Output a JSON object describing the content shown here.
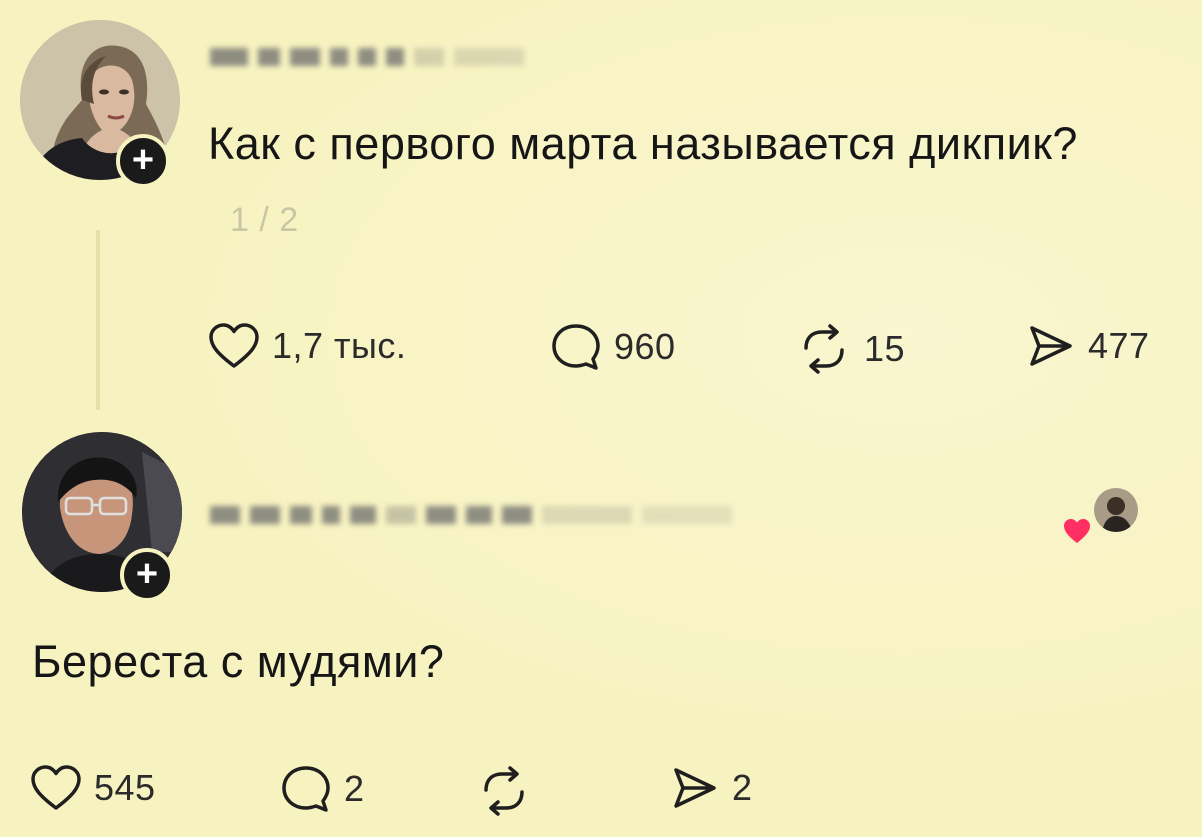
{
  "posts": [
    {
      "text": "Как  с первого марта называется дикпик?",
      "pager": "1 / 2",
      "stats": {
        "likes": "1,7 тыс.",
        "comments": "960",
        "reposts": "15",
        "shares": "477"
      }
    },
    {
      "text": "Береста с мудями?",
      "stats": {
        "likes": "545",
        "comments": "2",
        "reposts": "",
        "shares": "2"
      }
    }
  ],
  "icons": {
    "like": "heart-outline-icon",
    "comment": "speech-bubble-icon",
    "repost": "repost-arrows-icon",
    "share": "send-arrow-icon",
    "follow": "plus-icon",
    "liked_by_author": "heart-filled-icon"
  },
  "colors": {
    "background": "#f7f3c0",
    "text": "#161616",
    "heart": "#ff2e63",
    "badge": "#1a1a1a"
  }
}
